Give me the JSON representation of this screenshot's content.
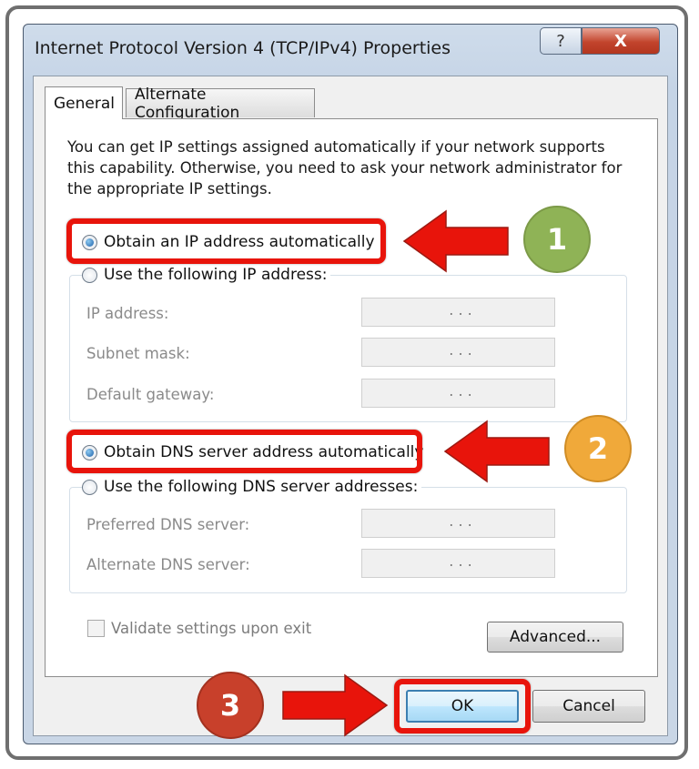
{
  "window": {
    "title": "Internet Protocol Version 4 (TCP/IPv4) Properties",
    "help_symbol": "?",
    "close_symbol": "X"
  },
  "tabs": [
    {
      "label": "General",
      "active": true
    },
    {
      "label": "Alternate Configuration",
      "active": false
    }
  ],
  "description": "You can get IP settings assigned automatically if your network supports this capability. Otherwise, you need to ask your network administrator for the appropriate IP settings.",
  "ip_section": {
    "auto_label": "Obtain an IP address automatically",
    "auto_selected": true,
    "manual_label": "Use the following IP address:",
    "manual_selected": false,
    "fields": [
      {
        "label": "IP address:",
        "value": ". . ."
      },
      {
        "label": "Subnet mask:",
        "value": ". . ."
      },
      {
        "label": "Default gateway:",
        "value": ". . ."
      }
    ]
  },
  "dns_section": {
    "auto_label": "Obtain DNS server address automatically",
    "auto_selected": true,
    "manual_label": "Use the following DNS server addresses:",
    "manual_selected": false,
    "fields": [
      {
        "label": "Preferred DNS server:",
        "value": ". . ."
      },
      {
        "label": "Alternate DNS server:",
        "value": ". . ."
      }
    ]
  },
  "validate_label": "Validate settings upon exit",
  "validate_checked": false,
  "buttons": {
    "advanced": "Advanced...",
    "ok": "OK",
    "cancel": "Cancel"
  },
  "annotations": {
    "step1": "1",
    "step2": "2",
    "step3": "3",
    "step1_color": "#8fb356",
    "step2_color": "#f0a93a",
    "step3_color": "#c8402b",
    "highlight_color": "#e8140b"
  }
}
